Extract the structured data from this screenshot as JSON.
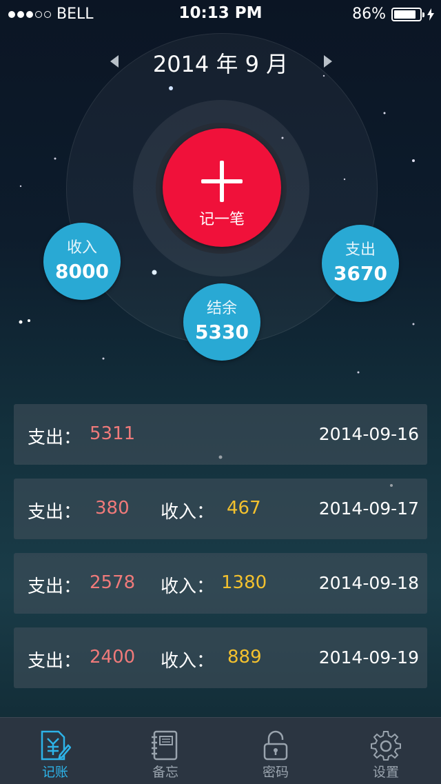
{
  "status_bar": {
    "carrier": "BELL",
    "time": "10:13 PM",
    "battery": "86%",
    "battery_level": 0.86,
    "signal_bars": 3
  },
  "header": {
    "month": "2014 年 9 月"
  },
  "add_button": {
    "label": "记一笔"
  },
  "summary": {
    "income": {
      "label": "收入",
      "value": "8000"
    },
    "expense": {
      "label": "支出",
      "value": "3670"
    },
    "balance": {
      "label": "结余",
      "value": "5330"
    }
  },
  "records": [
    {
      "expense_label": "支出：",
      "expense": "5311",
      "income_label": "",
      "income": "",
      "date": "2014-09-16"
    },
    {
      "expense_label": "支出：",
      "expense": "380",
      "income_label": "收入：",
      "income": "467",
      "date": "2014-09-17"
    },
    {
      "expense_label": "支出：",
      "expense": "2578",
      "income_label": "收入：",
      "income": "1380",
      "date": "2014-09-18"
    },
    {
      "expense_label": "支出：",
      "expense": "2400",
      "income_label": "收入：",
      "income": "889",
      "date": "2014-09-19"
    }
  ],
  "tabs": [
    {
      "label": "记账",
      "icon": "ledger-icon",
      "active": true
    },
    {
      "label": "备忘",
      "icon": "notebook-icon",
      "active": false
    },
    {
      "label": "密码",
      "icon": "lock-icon",
      "active": false
    },
    {
      "label": "设置",
      "icon": "gear-icon",
      "active": false
    }
  ],
  "colors": {
    "accent": "#2db3e8",
    "add_button": "#f0113a",
    "bubble": "#29a9d4",
    "expense_text": "#f07a7a",
    "income_text": "#f3c12e"
  }
}
